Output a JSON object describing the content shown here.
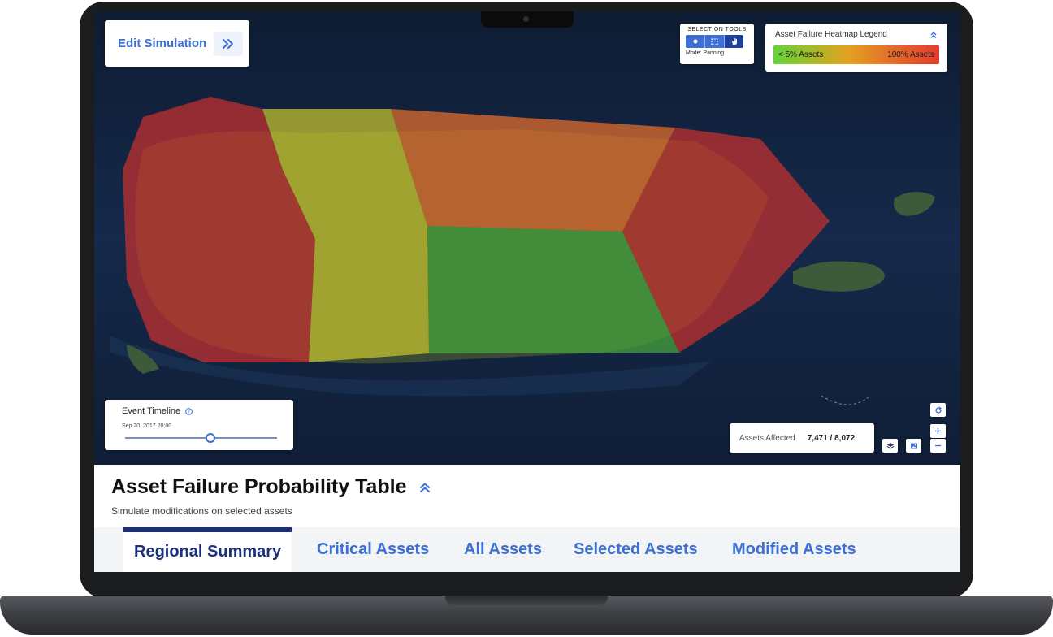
{
  "header": {
    "edit_simulation_label": "Edit Simulation"
  },
  "selection_tools": {
    "title": "SELECTION TOOLS",
    "mode": "Mode: Panning",
    "tools": [
      "point-select",
      "box-select",
      "pan"
    ],
    "active_tool": "pan"
  },
  "legend": {
    "title": "Asset Failure Heatmap Legend",
    "low_label": "< 5% Assets",
    "high_label": "100% Assets",
    "gradient_colors": [
      "#62d43a",
      "#e4a020",
      "#e3702a",
      "#e33c2c"
    ]
  },
  "timeline": {
    "title": "Event Timeline",
    "date": "Sep 20, 2017 20:00",
    "progress": 0.55
  },
  "assets_affected": {
    "label": "Assets Affected",
    "value": "7,471 / 8,072"
  },
  "map_regions": [
    {
      "name": "west",
      "risk": "high",
      "color": "#d2322d"
    },
    {
      "name": "west-central",
      "risk": "moderate",
      "color": "#c7c62e"
    },
    {
      "name": "north-central",
      "risk": "elevated",
      "color": "#e56f2c"
    },
    {
      "name": "south-central",
      "risk": "low",
      "color": "#47a83c"
    },
    {
      "name": "east",
      "risk": "high",
      "color": "#d2322d"
    }
  ],
  "table": {
    "title": "Asset Failure Probability Table",
    "subtitle": "Simulate modifications on selected assets",
    "tabs": [
      {
        "label": "Regional Summary"
      },
      {
        "label": "Critical Assets"
      },
      {
        "label": "All Assets"
      },
      {
        "label": "Selected Assets"
      },
      {
        "label": "Modified Assets"
      }
    ],
    "active_tab": "Regional Summary"
  },
  "colors": {
    "accent": "#3b6fd4",
    "active_tab": "#1b2f7e"
  }
}
